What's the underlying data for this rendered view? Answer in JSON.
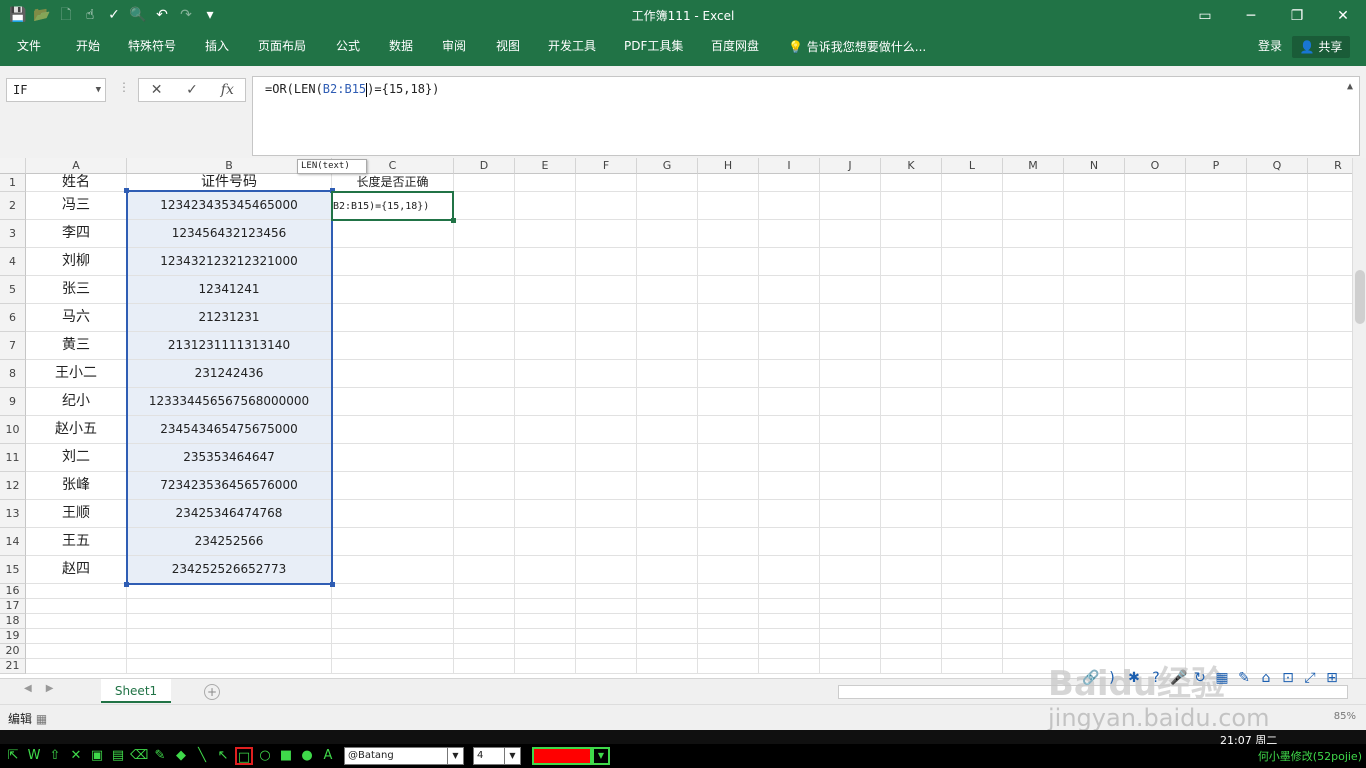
{
  "window": {
    "title": "工作簿111 - Excel"
  },
  "ribbon": {
    "tabs": [
      "文件",
      "开始",
      "特殊符号",
      "插入",
      "页面布局",
      "公式",
      "数据",
      "审阅",
      "视图",
      "开发工具",
      "PDF工具集",
      "百度网盘"
    ],
    "tell_me": "告诉我您想要做什么...",
    "login": "登录",
    "share": "共享"
  },
  "formula_bar": {
    "name_box": "IF",
    "formula_pre": "=OR(LEN(",
    "formula_ref": "B2:B15",
    "formula_post": ")={15,18})",
    "tooltip": "LEN(text)"
  },
  "sheet": {
    "columns": [
      "A",
      "B",
      "C",
      "D",
      "E",
      "F",
      "G",
      "H",
      "I",
      "J",
      "K",
      "L",
      "M",
      "N",
      "O",
      "P",
      "Q",
      "R"
    ],
    "rows": [
      "1",
      "2",
      "3",
      "4",
      "5",
      "6",
      "7",
      "8",
      "9",
      "10",
      "11",
      "12",
      "13",
      "14",
      "15",
      "16",
      "17",
      "18",
      "19",
      "20",
      "21"
    ],
    "headers": {
      "a": "姓名",
      "b": "证件号码",
      "c": "长度是否正确"
    },
    "records": [
      {
        "name": "冯三",
        "id": "123423435345465000"
      },
      {
        "name": "李四",
        "id": "123456432123456"
      },
      {
        "name": "刘柳",
        "id": "123432123212321000"
      },
      {
        "name": "张三",
        "id": "12341241"
      },
      {
        "name": "马六",
        "id": "21231231"
      },
      {
        "name": "黄三",
        "id": "2131231111313140"
      },
      {
        "name": "王小二",
        "id": "231242436"
      },
      {
        "name": "纪小",
        "id": "123334456567568000000"
      },
      {
        "name": "赵小五",
        "id": "234543465475675000"
      },
      {
        "name": "刘二",
        "id": "235353464647"
      },
      {
        "name": "张峰",
        "id": "723423536456576000"
      },
      {
        "name": "王顺",
        "id": "23425346474768"
      },
      {
        "name": "王五",
        "id": "234252566"
      },
      {
        "name": "赵四",
        "id": "234252526652773"
      }
    ],
    "edit_cell_text": "B2:B15)={15,18})"
  },
  "sheet_tabs": {
    "active": "Sheet1"
  },
  "status": {
    "mode": "编辑",
    "zoom": "85%"
  },
  "drawbar": {
    "font": "@Batang",
    "size": "4",
    "credit": "何小墨修改(52pojie)"
  },
  "clock": "21:07 周二",
  "watermark": {
    "brand": "Baidu经验",
    "url": "jingyan.baidu.com"
  },
  "colors": {
    "excel_green": "#217346",
    "selection_blue": "#2f5db4",
    "pen_red": "#ff0000"
  }
}
